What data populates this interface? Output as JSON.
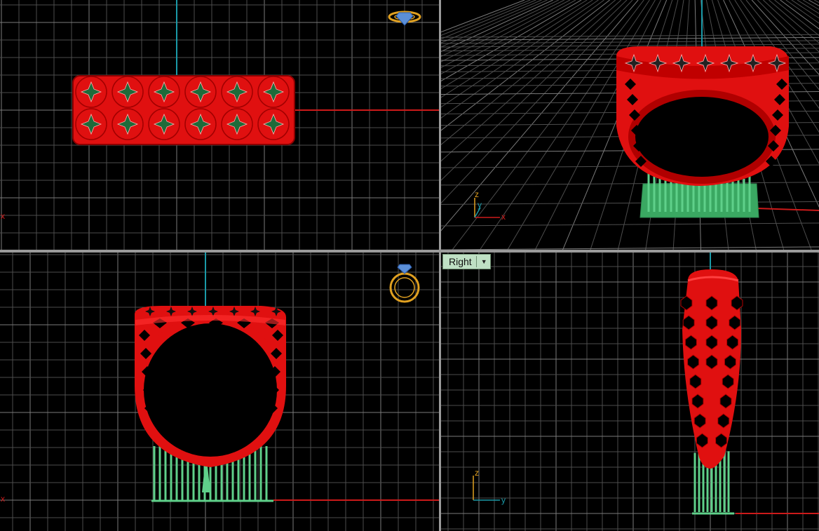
{
  "viewports": {
    "top": {
      "axes": {
        "x_label": "x"
      }
    },
    "perspective": {
      "axes": {
        "z_label": "z",
        "y_label": "y",
        "x_label": "x"
      }
    },
    "front": {
      "axes": {
        "x_label": "x"
      }
    },
    "right": {
      "label": "Right",
      "axes": {
        "z_label": "z",
        "y_label": "y"
      }
    }
  },
  "colors": {
    "background": "#000000",
    "grid_minor": "#4d4d4d",
    "grid_major": "#7a7a7a",
    "axis_x": "#cc1a1a",
    "axis_z": "#1a9aa8",
    "ring": "#e01010",
    "supports": "#4fc27a",
    "label_bg": "#bfe0c4"
  },
  "icons": [
    "ring-top-view-icon",
    "ring-front-view-icon",
    "viewport-dropdown-icon"
  ]
}
